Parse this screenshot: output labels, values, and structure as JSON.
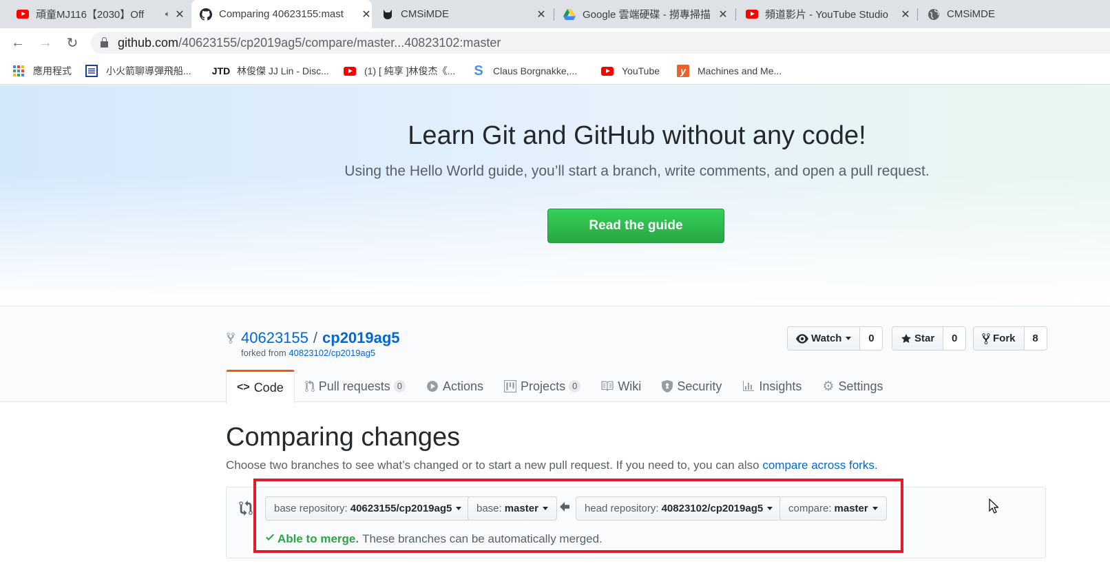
{
  "browser": {
    "tabs": [
      {
        "title": "頑童MJ116【2030】Off",
        "icon": "youtube-icon",
        "active": false
      },
      {
        "title": "Comparing 40623155:mast",
        "icon": "github-icon",
        "active": true
      },
      {
        "title": "CMSiMDE",
        "icon": "cmsimde-cat-icon",
        "active": false
      },
      {
        "title": "Google 雲端硬碟 - 撈專掃描",
        "icon": "google-drive-icon",
        "active": false
      },
      {
        "title": "頻道影片 - YouTube Studio",
        "icon": "youtube-icon",
        "active": false
      },
      {
        "title": "CMSiMDE",
        "icon": "globe-icon",
        "active": false
      }
    ],
    "url_host": "github.com",
    "url_path": "/40623155/cp2019ag5/compare/master...40823102:master",
    "bookmarks": [
      {
        "label": "應用程式",
        "icon": "apps-grid-icon"
      },
      {
        "label": "小火箭聊導彈飛船...",
        "icon": "document-icon"
      },
      {
        "label": "林俊傑 JJ Lin - Disc...",
        "icon": "jtd-logo-icon"
      },
      {
        "label": "(1) [ 純享 ]林俊杰《...",
        "icon": "youtube-icon"
      },
      {
        "label": "Claus Borgnakke,...",
        "icon": "s-logo-icon"
      },
      {
        "label": "YouTube",
        "icon": "youtube-icon"
      },
      {
        "label": "Machines and Me...",
        "icon": "y-logo-icon"
      }
    ]
  },
  "banner": {
    "title": "Learn Git and GitHub without any code!",
    "subtitle": "Using the Hello World guide, you’ll start a branch, write comments, and open a pull request.",
    "button": "Read the guide"
  },
  "repo": {
    "owner": "40623155",
    "name": "cp2019ag5",
    "forked_prefix": "forked from",
    "forked_from": "40823102/cp2019ag5",
    "watch_label": "Watch",
    "watch_count": "0",
    "star_label": "Star",
    "star_count": "0",
    "fork_label": "Fork",
    "fork_count": "8"
  },
  "nav": {
    "code": "Code",
    "pulls": "Pull requests",
    "pulls_count": "0",
    "actions": "Actions",
    "projects": "Projects",
    "projects_count": "0",
    "wiki": "Wiki",
    "security": "Security",
    "insights": "Insights",
    "settings": "Settings"
  },
  "compare": {
    "title": "Comparing changes",
    "desc": "Choose two branches to see what’s changed or to start a new pull request. If you need to, you can also",
    "desc_link": "compare across forks",
    "base_repo_label": "base repository:",
    "base_repo_value": "40623155/cp2019ag5",
    "base_label": "base:",
    "base_value": "master",
    "head_repo_label": "head repository:",
    "head_repo_value": "40823102/cp2019ag5",
    "compare_label": "compare:",
    "compare_value": "master",
    "merge_ok": "Able to merge.",
    "merge_msg": "These branches can be automatically merged."
  },
  "colors": {
    "accent": "#0366d6",
    "success": "#28a745",
    "highlight": "#e11c2a",
    "tab_underline": "#e36209"
  }
}
